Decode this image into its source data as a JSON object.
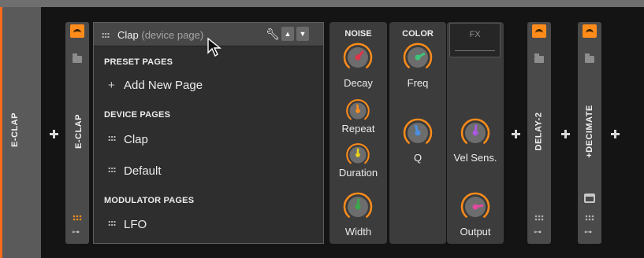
{
  "track": {
    "name": "E-CLAP"
  },
  "devices": [
    {
      "name": "E-CLAP"
    },
    {
      "name": "DELAY-2"
    },
    {
      "name": "+DECIMATE"
    }
  ],
  "popup": {
    "title": "Clap",
    "subtitle": "(device page)",
    "sections": {
      "preset_pages": "PRESET PAGES",
      "device_pages": "DEVICE PAGES",
      "modulator_pages": "MODULATOR PAGES"
    },
    "add_new_page": "Add New Page",
    "device_page_items": [
      "Clap",
      "Default"
    ],
    "modulator_page_items": [
      "LFO"
    ]
  },
  "panels": {
    "noise": {
      "title": "NOISE",
      "params": [
        {
          "label": "Decay",
          "color": "#e0334a"
        },
        {
          "label": "Repeat",
          "color": "#ff8c1a"
        },
        {
          "label": "Duration",
          "color": "#e8d21a"
        },
        {
          "label": "Width",
          "color": "#3aa84a"
        }
      ]
    },
    "color": {
      "title": "COLOR",
      "params": [
        {
          "label": "Freq",
          "color": "#3ec47a"
        },
        {
          "label": "Q",
          "color": "#4a8fe0"
        }
      ]
    },
    "fx": {
      "title": "FX",
      "params": [
        {
          "label": "Vel Sens.",
          "color": "#a85ae0"
        },
        {
          "label": "Output",
          "color": "#e04aa0"
        }
      ]
    }
  },
  "colors": {
    "accent": "#ff6a1a",
    "device_button": "#ff8c1a"
  },
  "icons": {
    "add": "plus-icon",
    "wrench": "wrench-icon",
    "move_up": "triangle-up-icon",
    "move_down": "triangle-down-icon"
  }
}
